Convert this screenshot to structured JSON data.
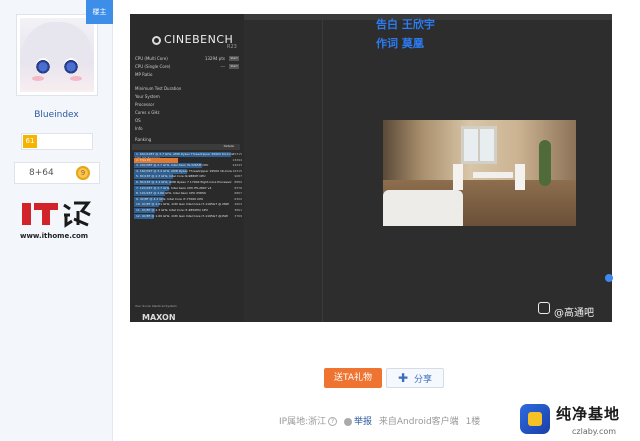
{
  "user": {
    "corner_badge": "楼主",
    "name": "Blueindex",
    "level_tag": "61",
    "stat": "8+64",
    "medal": "9"
  },
  "watermark_source": {
    "logo_text": "IT之家",
    "url": "www.ithome.com"
  },
  "cinebench": {
    "window_title": "CINEBENCH R23",
    "title": "CINEBENCH",
    "subtitle": "R23",
    "rows": [
      {
        "label": "CPU (Multi Core)",
        "value": "13294 pts",
        "button": "Start"
      },
      {
        "label": "CPU (Single Core)",
        "value": "---",
        "button": "Start"
      },
      {
        "label": "MP Ratio",
        "value": "",
        "button": ""
      },
      {
        "label": "Minimum Test Duration",
        "value": "",
        "button": ""
      },
      {
        "label": "Your System",
        "value": "",
        "button": ""
      },
      {
        "label": "Processor",
        "value": "",
        "button": ""
      },
      {
        "label": "Cores x GHz",
        "value": "",
        "button": ""
      },
      {
        "label": "OS",
        "value": "",
        "button": ""
      },
      {
        "label": "Info",
        "value": "",
        "button": ""
      },
      {
        "label": "Ranking",
        "value": "",
        "button": ""
      }
    ],
    "ranking_header": "CPU (Multi Core)",
    "ranking_details": "Details",
    "ranking": [
      {
        "label": "1. 64C/128T @ 2.7 GHz, AMD Ryzen Threadripper 3990X 64-Core",
        "value": "75315",
        "pct": 100,
        "highlight": false
      },
      {
        "label": "2. This PC",
        "value": "13294",
        "pct": 45,
        "highlight": true
      },
      {
        "label": "3. 24C/48T @ 2.7 GHz, Intel Xeon W-3265M CPU",
        "value": "24243",
        "pct": 70,
        "highlight": false
      },
      {
        "label": "4. 16C/32T @ 3.4 GHz, AMD Ryzen Threadripper 1950X 16-Core",
        "value": "16315",
        "pct": 55,
        "highlight": false
      },
      {
        "label": "5. 8C/16T @ 2.3 GHz, Intel Core i9-9880H CPU",
        "value": "9087",
        "pct": 40,
        "highlight": false
      },
      {
        "label": "6. 8C/16T @ 3.4 GHz, AMD Ryzen 7 1700X Eight-Core Processor",
        "value": "8889",
        "pct": 38,
        "highlight": false
      },
      {
        "label": "7. 12C/24T @ 2.7 GHz, Intel Xeon CPU E5-2697 v2",
        "value": "8378",
        "pct": 36,
        "highlight": false
      },
      {
        "label": "8. 12C/24T @ 2.66 GHz, Intel Xeon CPU X5650",
        "value": "6867",
        "pct": 32,
        "highlight": false
      },
      {
        "label": "9. 4C/8T @ 4.2 GHz, Intel Core i7-7700K CPU",
        "value": "6302",
        "pct": 30,
        "highlight": false
      },
      {
        "label": "10. 4C/8T @ 2.81 GHz, 11th Gen Intel Core i7-1165G7 @ 28W",
        "value": "4904",
        "pct": 26,
        "highlight": false
      },
      {
        "label": "11. 4C/8T @ 2.3 GHz, Intel Core i7-4850HQ CPU",
        "value": "3891",
        "pct": 22,
        "highlight": false
      },
      {
        "label": "12. 4C/8T @ 1.69 GHz, 11th Gen Intel Core i7-1165G7 @15W",
        "value": "3769",
        "pct": 21,
        "highlight": false
      }
    ],
    "footer_checks": "Your Score   Identical System",
    "maxon": "MAXON"
  },
  "overlay": {
    "lyric_line_1": "告白    王欣宇",
    "lyric_line_2": "作词    莫凰",
    "video_watermark": "@高通吧"
  },
  "actions": {
    "gift_label": "送TA礼物",
    "share_label": "分享"
  },
  "meta": {
    "ip_location": "IP属地:浙江",
    "report": "举报",
    "client": "来自Android客户端",
    "floor": "1楼"
  },
  "site_logo": {
    "name": "纯净基地",
    "domain": "czlaby.com"
  },
  "colors": {
    "accent_blue": "#2b5aa0",
    "gift_orange": "#ef7431",
    "lyrics_blue": "#2d7bf0",
    "cinebench_bg": "#2d2d2d"
  }
}
